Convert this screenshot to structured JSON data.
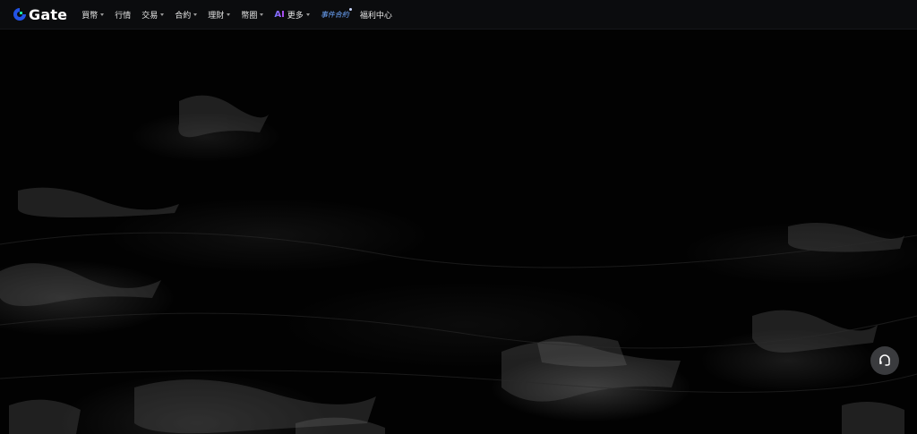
{
  "brand": {
    "name": "Gate",
    "accent": "#2354e6"
  },
  "nav": {
    "buy_crypto": "買幣",
    "markets": "行情",
    "trade": "交易",
    "futures": "合約",
    "earn": "理財",
    "coin_circle": "幣圈",
    "more": "更多",
    "ai_label": "AI",
    "event_futures": "事件合約",
    "rewards_hub": "福利中心"
  },
  "icons": {
    "support": "headset-icon",
    "dropdown": "caret-down-icon"
  }
}
